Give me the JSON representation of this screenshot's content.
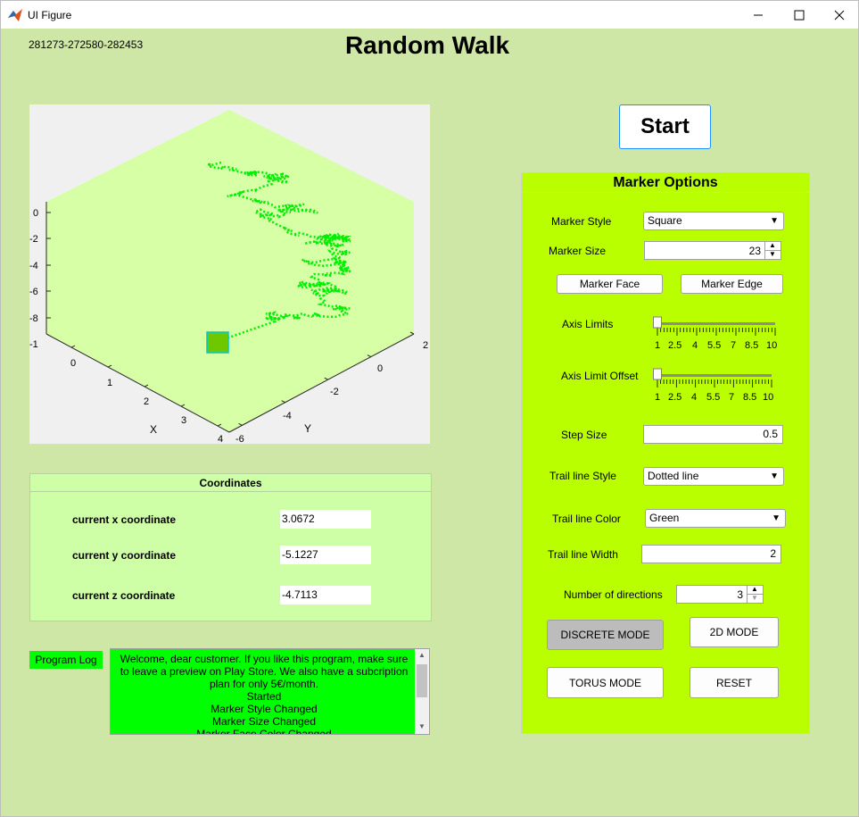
{
  "window": {
    "title": "UI Figure"
  },
  "header": {
    "id_text": "281273-272580-282453",
    "title": "Random Walk"
  },
  "plot": {
    "z_ticks": [
      "0",
      "-2",
      "-4",
      "-6",
      "-8",
      "-1"
    ],
    "x_ticks": [
      "0",
      "1",
      "2",
      "3",
      "4"
    ],
    "y_ticks": [
      "2",
      "0",
      "-2",
      "-4",
      "-6"
    ],
    "xlabel": "X",
    "ylabel": "Y",
    "colors": {
      "background": "#f0f0f0",
      "cube": "#d6ffa6",
      "trail": "#00ee00",
      "marker_face": "#6ec800",
      "marker_edge": "#00c8c8"
    }
  },
  "coordinates": {
    "title": "Coordinates",
    "x_label": "current x coordinate",
    "x_value": "3.0672",
    "y_label": "current y coordinate",
    "y_value": "-5.1227",
    "z_label": "current z coordinate",
    "z_value": "-4.7113"
  },
  "log": {
    "label": "Program Log",
    "lines": [
      "Welcome, dear customer. If you like this program, make sure",
      "to leave a preview on Play Store. We also have a subcription",
      "plan for only 5€/month.",
      "Started",
      "Marker Style Changed",
      "Marker Size Changed",
      "Marker Face Color Changed"
    ]
  },
  "start_label": "Start",
  "marker_options": {
    "title": "Marker Options",
    "style_label": "Marker Style",
    "style_value": "Square",
    "size_label": "Marker Size",
    "size_value": "23",
    "face_button": "Marker Face",
    "edge_button": "Marker Edge",
    "axis_limits_label": "Axis Limits",
    "axis_limit_offset_label": "Axis Limit Offset",
    "slider_ticks": [
      "1",
      "2.5",
      "4",
      "5.5",
      "7",
      "8.5",
      "10"
    ],
    "axis_limits_value": 1,
    "axis_limit_offset_value": 1,
    "slider_min": 1,
    "slider_max": 10,
    "step_label": "Step Size",
    "step_value": "0.5",
    "trail_style_label": "Trail line Style",
    "trail_style_value": "Dotted line",
    "trail_color_label": "Trail line Color",
    "trail_color_value": "Green",
    "trail_width_label": "Trail line Width",
    "trail_width_value": "2",
    "directions_label": "Number of directions",
    "directions_value": "3",
    "discrete_button": "DISCRETE MODE",
    "mode2d_button": "2D MODE",
    "torus_button": "TORUS MODE",
    "reset_button": "RESET"
  },
  "colors": {
    "client_bg": "#cfe7a6",
    "panel_bg": "#baff00",
    "coord_bg": "#cefea6",
    "log_bg": "#00ff00",
    "start_border": "#1e90ff"
  }
}
